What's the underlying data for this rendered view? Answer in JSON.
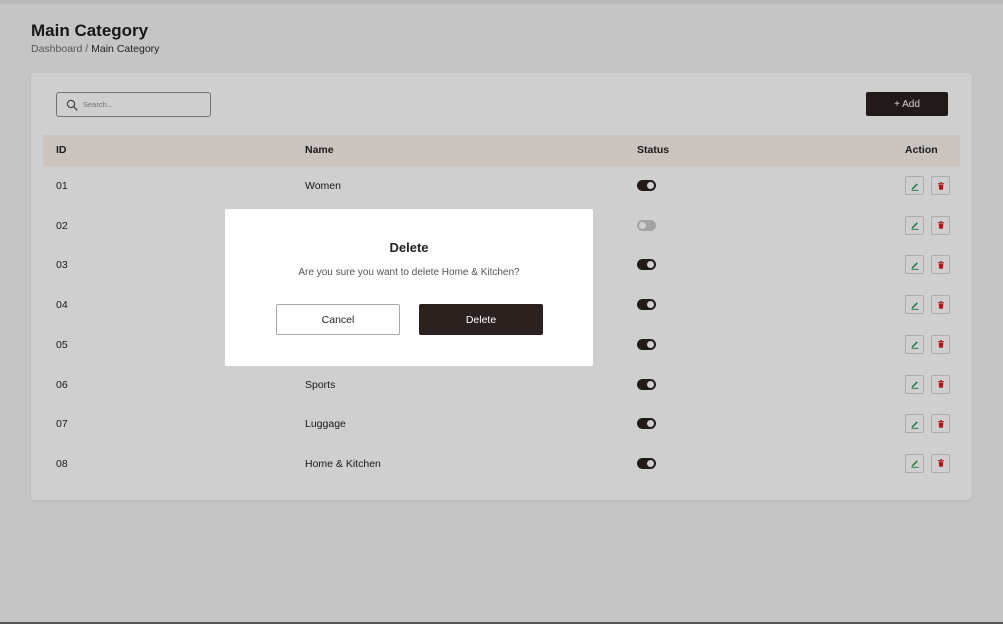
{
  "header": {
    "title": "Main Category",
    "breadcrumb": {
      "parent": "Dashboard",
      "separator": " / ",
      "current": "Main Category"
    }
  },
  "toolbar": {
    "search_placeholder": "Search...",
    "add_label": "+ Add"
  },
  "table": {
    "columns": {
      "id": "ID",
      "name": "Name",
      "status": "Status",
      "action": "Action"
    },
    "rows": [
      {
        "id": "01",
        "name": "Women",
        "status_on": true
      },
      {
        "id": "02",
        "name": "",
        "status_on": false
      },
      {
        "id": "03",
        "name": "",
        "status_on": true
      },
      {
        "id": "04",
        "name": "",
        "status_on": true
      },
      {
        "id": "05",
        "name": "",
        "status_on": true
      },
      {
        "id": "06",
        "name": "Sports",
        "status_on": true
      },
      {
        "id": "07",
        "name": "Luggage",
        "status_on": true
      },
      {
        "id": "08",
        "name": "Home & Kitchen",
        "status_on": true
      }
    ]
  },
  "modal": {
    "title": "Delete",
    "message": "Are you sure you want to delete Home & Kitchen?",
    "cancel_label": "Cancel",
    "confirm_label": "Delete"
  },
  "colors": {
    "primary": "#2b211e",
    "edit_icon": "#1f8a4c",
    "delete_icon": "#e01e1e",
    "table_header_bg": "#fbf0eb"
  },
  "icons": {
    "search": "search-icon",
    "edit": "pencil-icon",
    "delete": "trash-icon"
  }
}
